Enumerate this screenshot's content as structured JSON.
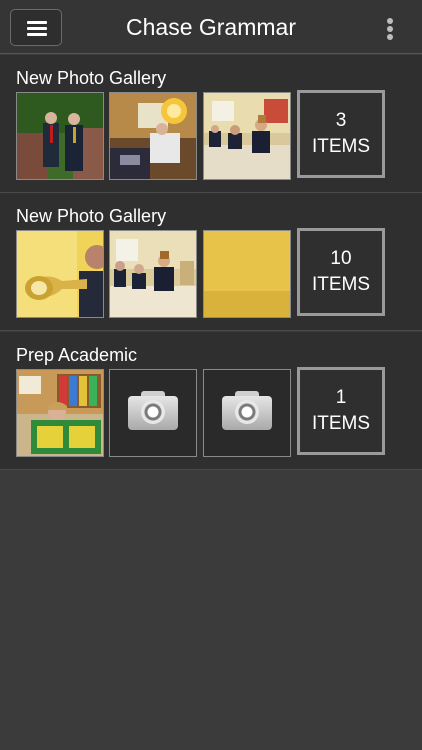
{
  "app": {
    "title": "Chase Grammar"
  },
  "topbar": {
    "menu_icon": "hamburger-menu-icon",
    "more_icon": "vertical-dots-icon"
  },
  "galleries": [
    {
      "title": "New Photo Gallery",
      "count": "3",
      "count_label": "ITEMS"
    },
    {
      "title": "New Photo Gallery",
      "count": "10",
      "count_label": "ITEMS"
    },
    {
      "title": "Prep Academic",
      "count": "1",
      "count_label": "ITEMS"
    }
  ],
  "colors": {
    "background": "#3b3b3b",
    "panel": "#2f2f2f",
    "text": "#ffffff"
  }
}
